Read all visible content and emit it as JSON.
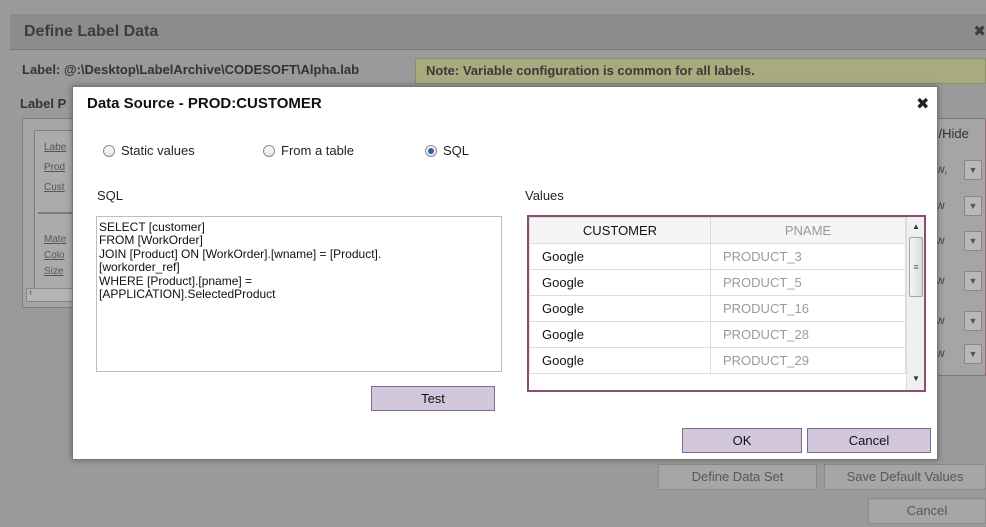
{
  "background_window": {
    "title": "Define Label Data",
    "close_glyph": "✖",
    "label_path": "Label: @:\\Desktop\\LabelArchive\\CODESOFT\\Alpha.lab",
    "note": "Note: Variable configuration is common for all labels.",
    "label_prop_fragment": "Label P",
    "left_links": [
      "Labe",
      "Prod",
      "Cust",
      "Mate",
      "Colo",
      "Size"
    ],
    "show_hide_fragment": "v/Hide",
    "dropdowns": [
      "w,",
      "w",
      "w",
      "w",
      "w",
      "w"
    ],
    "buttons": {
      "define_data_set": "Define Data Set",
      "save_default_values": "Save Default Values",
      "cancel": "Cancel"
    }
  },
  "dialog": {
    "title": "Data Source - PROD:CUSTOMER",
    "close_glyph": "✖",
    "source_options": [
      {
        "label": "Static values",
        "selected": false
      },
      {
        "label": "From a table",
        "selected": false
      },
      {
        "label": "SQL",
        "selected": true
      }
    ],
    "sql_label": "SQL",
    "sql_text": "SELECT [customer]\nFROM [WorkOrder]\nJOIN [Product] ON [WorkOrder].[wname] = [Product].\n[workorder_ref]\nWHERE [Product].[pname] =\n[APPLICATION].SelectedProduct",
    "test_button": "Test",
    "values_label": "Values",
    "values_table": {
      "columns": [
        "CUSTOMER",
        "PNAME"
      ],
      "rows": [
        [
          "Google",
          "PRODUCT_3"
        ],
        [
          "Google",
          "PRODUCT_5"
        ],
        [
          "Google",
          "PRODUCT_16"
        ],
        [
          "Google",
          "PRODUCT_28"
        ],
        [
          "Google",
          "PRODUCT_29"
        ]
      ]
    },
    "ok_button": "OK",
    "cancel_button": "Cancel"
  },
  "colors": {
    "button_fill": "#d3c7de",
    "grid_border": "#8f4b74",
    "radio_selected": "#2f5fb0"
  },
  "icons": {
    "close": "close-icon",
    "radio": "radio-icon",
    "scroll_up": "scroll-up-icon",
    "scroll_down": "scroll-down-icon",
    "dropdown": "chevron-down-icon"
  }
}
